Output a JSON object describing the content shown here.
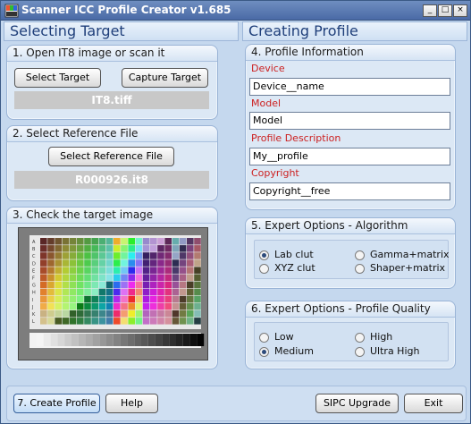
{
  "window": {
    "title": "Scanner ICC Profile Creator v1.685",
    "controls": [
      "_",
      "□",
      "×"
    ]
  },
  "left": {
    "header": "Selecting Target",
    "open_section": {
      "title": "1. Open IT8 image or scan it",
      "select_target": "Select Target",
      "capture_target": "Capture Target",
      "file": "IT8.tiff"
    },
    "reference_section": {
      "title": "2. Select Reference File",
      "select_reference": "Select Reference File",
      "file": "R000926.it8"
    },
    "check_section": {
      "title": "3. Check the target image"
    }
  },
  "right": {
    "header": "Creating Profile",
    "info": {
      "title": "4. Profile Information",
      "device_label": "Device",
      "device_value": "Device__name",
      "model_label": "Model",
      "model_value": "Model",
      "description_label": "Profile Description",
      "description_value": "My__profile",
      "copyright_label": "Copyright",
      "copyright_value": "Copyright__free"
    },
    "algorithm": {
      "title": "5. Expert Options - Algorithm",
      "options": [
        {
          "label": "Lab clut",
          "selected": true
        },
        {
          "label": "Gamma+matrix",
          "selected": false
        },
        {
          "label": "XYZ clut",
          "selected": false
        },
        {
          "label": "Shaper+matrix",
          "selected": false
        }
      ]
    },
    "quality": {
      "title": "6. Expert Options - Profile Quality",
      "options": [
        {
          "label": "Low",
          "selected": false
        },
        {
          "label": "High",
          "selected": false
        },
        {
          "label": "Medium",
          "selected": true
        },
        {
          "label": "Ultra High",
          "selected": false
        }
      ]
    }
  },
  "bottom": {
    "create_profile": "7. Create Profile",
    "help": "Help",
    "sipc_upgrade": "SIPC Upgrade",
    "exit": "Exit"
  },
  "target_image": {
    "row_labels": [
      "A",
      "B",
      "C",
      "D",
      "E",
      "F",
      "G",
      "H",
      "I",
      "J",
      "K",
      "L"
    ]
  }
}
